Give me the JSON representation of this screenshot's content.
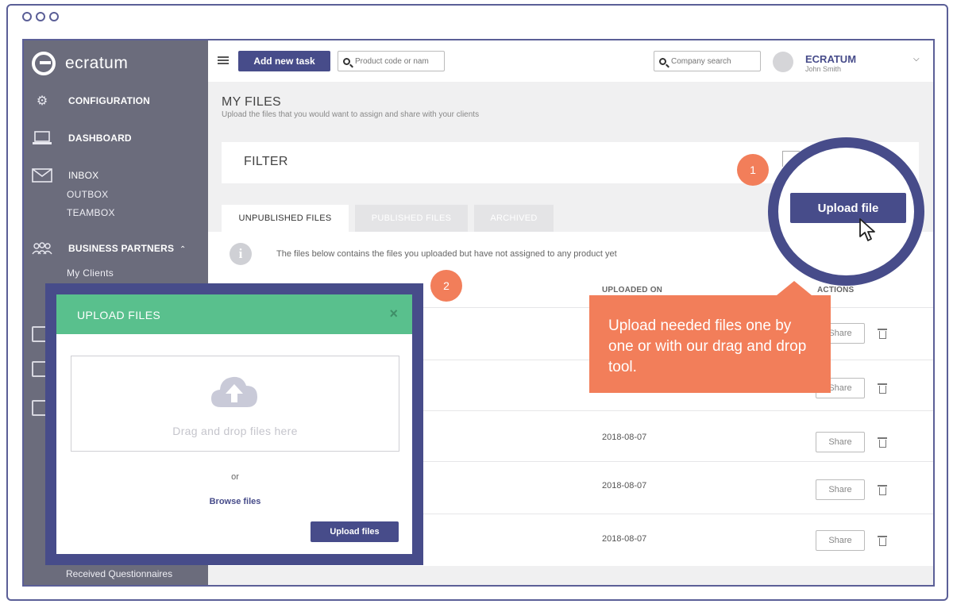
{
  "app": {
    "logo_text": "ecratum"
  },
  "sidebar": {
    "items": [
      {
        "label": "CONFIGURATION",
        "icon": "gears-icon"
      },
      {
        "label": "DASHBOARD",
        "icon": "laptop-icon"
      },
      {
        "label": "INBOX",
        "icon": "envelope-icon"
      },
      {
        "label": "BUSINESS PARTNERS",
        "icon": "people-icon"
      }
    ],
    "sub_items": [
      "OUTBOX",
      "TEAMBOX",
      "My Clients"
    ],
    "bottom_item": "Received Questionnaires"
  },
  "topbar": {
    "add_task_label": "Add new task",
    "product_search_placeholder": "Product code or nam",
    "company_search_placeholder": "Company search",
    "user_company": "ECRATUM",
    "user_name": "John Smith"
  },
  "page": {
    "title": "MY FILES",
    "subtitle": "Upload the files that you would want to assign and share with your clients",
    "filter_title": "FILTER"
  },
  "tabs": [
    {
      "label": "UNPUBLISHED FILES",
      "active": true
    },
    {
      "label": "PUBLISHED FILES",
      "active": false
    },
    {
      "label": "ARCHIVED",
      "active": false
    }
  ],
  "files": {
    "info_text": "The files below contains the files you uploaded but have not assigned to any product yet",
    "columns": {
      "uploaded_on": "UPLOADED ON",
      "actions": "ACTIONS"
    },
    "rows": [
      {
        "uploaded_on": "",
        "action": "Share"
      },
      {
        "uploaded_on": "",
        "action": "Share"
      },
      {
        "uploaded_on": "2018-08-07",
        "action": "Share"
      },
      {
        "uploaded_on": "2018-08-07",
        "action": "Share"
      },
      {
        "uploaded_on": "2018-08-07",
        "action": "Share"
      }
    ]
  },
  "callouts": {
    "step1": "1",
    "step2": "2",
    "tooltip": "Upload needed files one by one or with our drag and drop tool.",
    "upload_file_label": "Upload file"
  },
  "modal": {
    "title": "UPLOAD FILES",
    "close": "×",
    "dropzone_text": "Drag and drop files here",
    "or_text": "or",
    "browse_label": "Browse files",
    "upload_label": "Upload files"
  },
  "colors": {
    "sidebar": "#6b6c7c",
    "primary": "#474c8a",
    "accent": "#f27e5a",
    "modal_header": "#59c08d"
  }
}
